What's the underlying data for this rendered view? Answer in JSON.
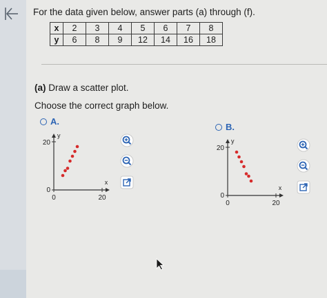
{
  "prompt": "For the data given below, answer parts (a) through (f).",
  "table": {
    "x_header": "x",
    "y_header": "y",
    "x_values": [
      "2",
      "3",
      "4",
      "5",
      "6",
      "7",
      "8"
    ],
    "y_values": [
      "6",
      "8",
      "9",
      "12",
      "14",
      "16",
      "18"
    ]
  },
  "part_a": {
    "label": "(a)",
    "text": "Draw a scatter plot."
  },
  "choose_text": "Choose the correct graph below.",
  "options": [
    {
      "letter": "A.",
      "graph": {
        "y_axis_label": "y",
        "x_axis_label": "x",
        "y_tick_top": "20",
        "y_tick_zero": "0",
        "x_tick_zero": "0",
        "x_tick_right": "20"
      }
    },
    {
      "letter": "B.",
      "graph": {
        "y_axis_label": "y",
        "x_axis_label": "x",
        "y_tick_top": "20",
        "y_tick_zero": "0",
        "x_tick_zero": "0",
        "x_tick_right": "20"
      }
    }
  ],
  "chart_data": [
    {
      "type": "scatter",
      "title": "",
      "xlabel": "x",
      "ylabel": "y",
      "xlim": [
        0,
        20
      ],
      "ylim": [
        0,
        20
      ],
      "point_color": "#d62b2b",
      "points": [
        [
          2,
          6
        ],
        [
          3,
          8
        ],
        [
          4,
          9
        ],
        [
          5,
          12
        ],
        [
          6,
          14
        ],
        [
          7,
          16
        ],
        [
          8,
          18
        ]
      ]
    },
    {
      "type": "scatter",
      "title": "",
      "xlabel": "x",
      "ylabel": "y",
      "xlim": [
        0,
        20
      ],
      "ylim": [
        0,
        20
      ],
      "point_color": "#d62b2b",
      "points": [
        [
          2,
          18
        ],
        [
          3,
          16
        ],
        [
          4,
          14
        ],
        [
          5,
          12
        ],
        [
          6,
          9
        ],
        [
          7,
          8
        ],
        [
          8,
          6
        ]
      ]
    }
  ],
  "colors": {
    "accent": "#2c64b4",
    "point": "#d62b2b"
  },
  "icons": [
    "back-arrow-icon",
    "zoom-in-icon",
    "zoom-out-icon",
    "expand-icon"
  ]
}
